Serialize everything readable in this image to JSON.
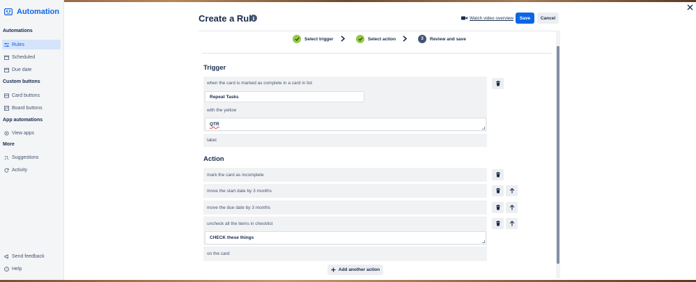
{
  "sidebar": {
    "brand": "Automation",
    "sections": {
      "automations": "Automations",
      "custom_buttons": "Custom buttons",
      "app_automations": "App automations",
      "more": "More"
    },
    "items": {
      "rules": "Rules",
      "scheduled": "Scheduled",
      "due_date": "Due date",
      "card_buttons": "Card buttons",
      "board_buttons": "Board buttons",
      "view_apps": "View apps",
      "suggestions": "Suggestions",
      "activity": "Activity",
      "send_feedback": "Send feedback",
      "help": "Help"
    }
  },
  "header": {
    "title": "Create a Rule",
    "info_glyph": "i",
    "video_link": "Watch video overview",
    "save_label": "Save",
    "cancel_label": "Cancel"
  },
  "steps": [
    {
      "label": "Select trigger",
      "state": "done"
    },
    {
      "label": "Select action",
      "state": "done"
    },
    {
      "label": "Review and save",
      "state": "current",
      "number": "3"
    }
  ],
  "trigger": {
    "heading": "Trigger",
    "line1": "when the card is marked as complete in a card in list",
    "list_value": "Repeat Tasks",
    "line2": "with the yellow",
    "label_value": "QTR",
    "line3": "label"
  },
  "action": {
    "heading": "Action",
    "items": {
      "a1": "mark the card as incomplete",
      "a2": "move the start date by 3 months",
      "a3": "move the due date by 3 months",
      "a4": "uncheck all the items in checklist",
      "checklist_value": "CHECK these things",
      "a4_suffix": "on the card"
    },
    "add_label": "Add another action"
  },
  "colors": {
    "accent": "#0c66e4",
    "active_bg": "#d5e3fb",
    "step_done": "#94c748",
    "row_bg": "#f1f2f4"
  },
  "icons": {
    "close": "close-icon",
    "trash": "trash-icon",
    "move_up": "arrow-up-icon",
    "video": "video-camera-icon",
    "add": "plus-icon"
  }
}
